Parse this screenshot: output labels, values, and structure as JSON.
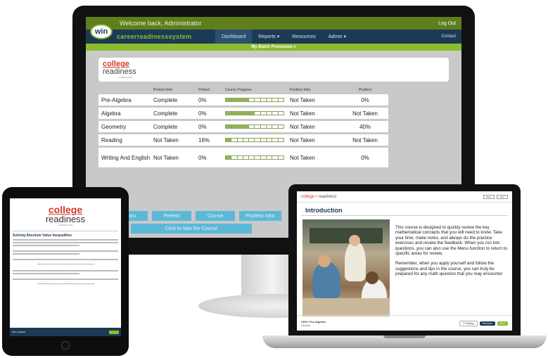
{
  "monitor": {
    "topbar": {
      "welcome": "Welcome back, Administrator",
      "logout": "Log Out"
    },
    "logo": "win",
    "brand": "careerreadinesssystem",
    "nav": [
      "Dashboard",
      "Reports",
      "Resources",
      "Admin"
    ],
    "contact": "Contact",
    "subbar": "My Batch Processes",
    "college_readiness": {
      "line1": "college",
      "line2": "readiness",
      "line3": "CURRICULUM"
    },
    "table": {
      "headers": [
        "Pretest Intro",
        "Pretest",
        "Course Progress",
        "Posttest Intro",
        "Posttest"
      ],
      "rows": [
        {
          "name": "Pre-Algebra",
          "pretest_intro": "Complete",
          "pretest": "0%",
          "progress": 0.4,
          "posttest_intro": "Not Taken",
          "posttest": "0%"
        },
        {
          "name": "Algebra",
          "pretest_intro": "Complete",
          "pretest": "0%",
          "progress": 0.5,
          "posttest_intro": "Not Taken",
          "posttest": "Not Taken"
        },
        {
          "name": "Geometry",
          "pretest_intro": "Complete",
          "pretest": "0%",
          "progress": 0.4,
          "posttest_intro": "Not Taken",
          "posttest": "40%"
        },
        {
          "name": "Reading",
          "pretest_intro": "Not Taken",
          "pretest": "16%",
          "progress": 0.1,
          "posttest_intro": "Not Taken",
          "posttest": "Not Taken"
        },
        {
          "name": "Writing And English",
          "pretest_intro": "Not Taken",
          "pretest": "0%",
          "progress": 0.1,
          "posttest_intro": "Not Taken",
          "posttest": "0%"
        }
      ]
    },
    "buttons": [
      "Intro",
      "Pretest",
      "Course",
      "Posttest Intro"
    ],
    "take_course": "Click to take the Course"
  },
  "tablet": {
    "logo": {
      "line1": "college",
      "line2": "readiness",
      "line3": "CURRICULUM"
    },
    "heading": "Solving Absolute Value Inequalities",
    "footer_title": "CRC+ Algebra"
  },
  "laptop": {
    "brand": {
      "part1": "college",
      "part2": "readiness"
    },
    "top_buttons": [
      "Menu",
      "Exit"
    ],
    "title": "Introduction",
    "paragraph1": "This course is designed to quickly review the key mathematical concepts that you will need to know. Take your time, make notes, and always do the practice exercises and review the feedback. When you run into questions, you can also use the Menu function to return to specific areas for review.",
    "paragraph2": "Remember, when you apply yourself and follow the suggestions and tips in the course, you can truly be prepared for any math question that you may encounter",
    "footer": {
      "course": "CRC+ Pre-Algebra",
      "section": "Review",
      "replay": "Replay",
      "previous": "Previous",
      "next": "Next"
    }
  }
}
